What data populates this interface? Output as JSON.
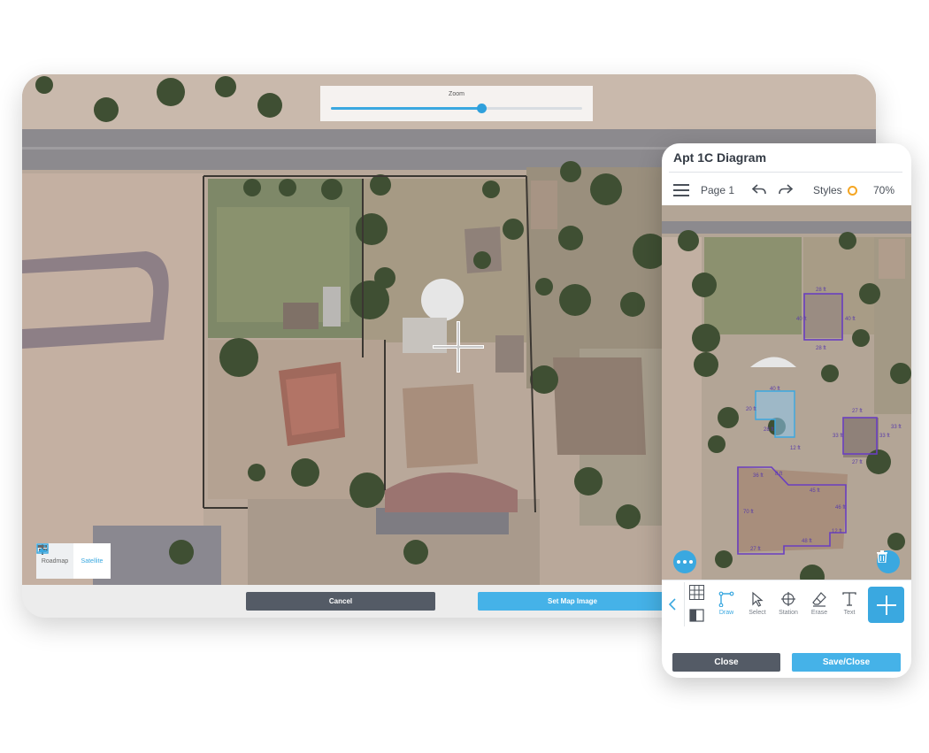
{
  "map_picker": {
    "zoom": {
      "label": "Zoom",
      "level_fraction": 0.6
    },
    "map_types": [
      {
        "label": "Roadmap",
        "icon": "signpost-icon",
        "selected": false
      },
      {
        "label": "Satellite",
        "icon": "image-icon",
        "selected": true
      }
    ],
    "cancel_label": "Cancel",
    "set_map_image_label": "Set Map Image"
  },
  "editor": {
    "title": "Apt 1C Diagram",
    "page_label": "Page 1",
    "styles_label": "Styles",
    "zoom_percent": "70%",
    "style_color": "#f5a623",
    "accent_color": "#3aa8e0",
    "outline_color": "#6a3fc0",
    "dimensions": {
      "top_structure": [
        "28 ft",
        "40 ft",
        "40 ft",
        "28 ft"
      ],
      "pool": [
        "40 ft",
        "20 ft",
        "28 ft",
        "12 ft"
      ],
      "garage": [
        "27 ft",
        "33 ft",
        "33 ft",
        "27 ft",
        "33 ft"
      ],
      "house": [
        "36 ft",
        "8 ft",
        "45 ft",
        "46 ft",
        "70 ft",
        "12 ft",
        "48 ft",
        "27 ft"
      ]
    },
    "tools": [
      {
        "label": "Draw",
        "icon": "draw-line-icon",
        "active": true
      },
      {
        "label": "Select",
        "icon": "cursor-icon",
        "active": false
      },
      {
        "label": "Station",
        "icon": "crosshair-icon",
        "active": false
      },
      {
        "label": "Erase",
        "icon": "eraser-icon",
        "active": false
      },
      {
        "label": "Text",
        "icon": "text-icon",
        "active": false
      }
    ],
    "close_label": "Close",
    "save_close_label": "Save/Close"
  }
}
